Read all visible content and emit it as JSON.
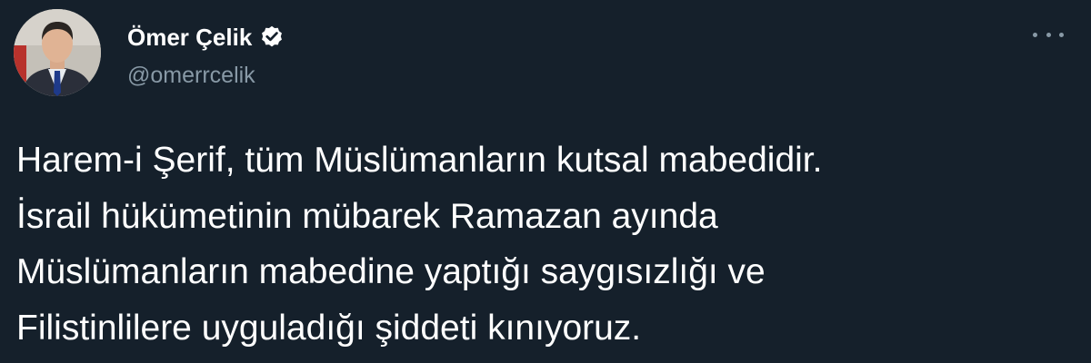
{
  "tweet": {
    "author": {
      "display_name": "Ömer Çelik",
      "handle": "@omerrcelik",
      "verified": true,
      "avatar_icon": "profile-photo",
      "verified_icon": "verified-badge-icon"
    },
    "more_icon": "more-options-icon",
    "text_lines": [
      "Harem-i Şerif, tüm Müslümanların kutsal mabedidir.",
      "İsrail hükümetinin mübarek Ramazan ayında",
      "Müslümanların mabedine yaptığı saygısızlığı ve",
      "Filistinlilere uyguladığı şiddeti kınıyoruz."
    ]
  },
  "colors": {
    "background": "#15202b",
    "text_primary": "#ffffff",
    "text_secondary": "#8899a6"
  }
}
